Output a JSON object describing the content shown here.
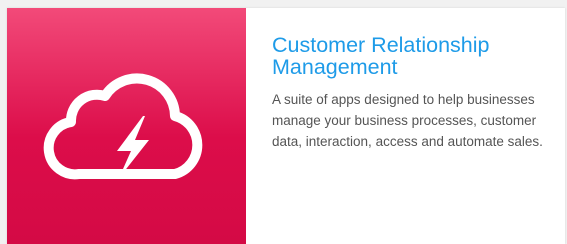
{
  "card": {
    "icon": "cloud-lightning-icon",
    "title": "Customer Relationship Management",
    "description": "A suite of apps designed to help businesses manage your business processes, customer data, interaction, access and automate sales.",
    "colors": {
      "media_gradient_top": "#f24a79",
      "media_gradient_bottom": "#d40a45",
      "title": "#1e9be8",
      "description": "#555555"
    }
  }
}
